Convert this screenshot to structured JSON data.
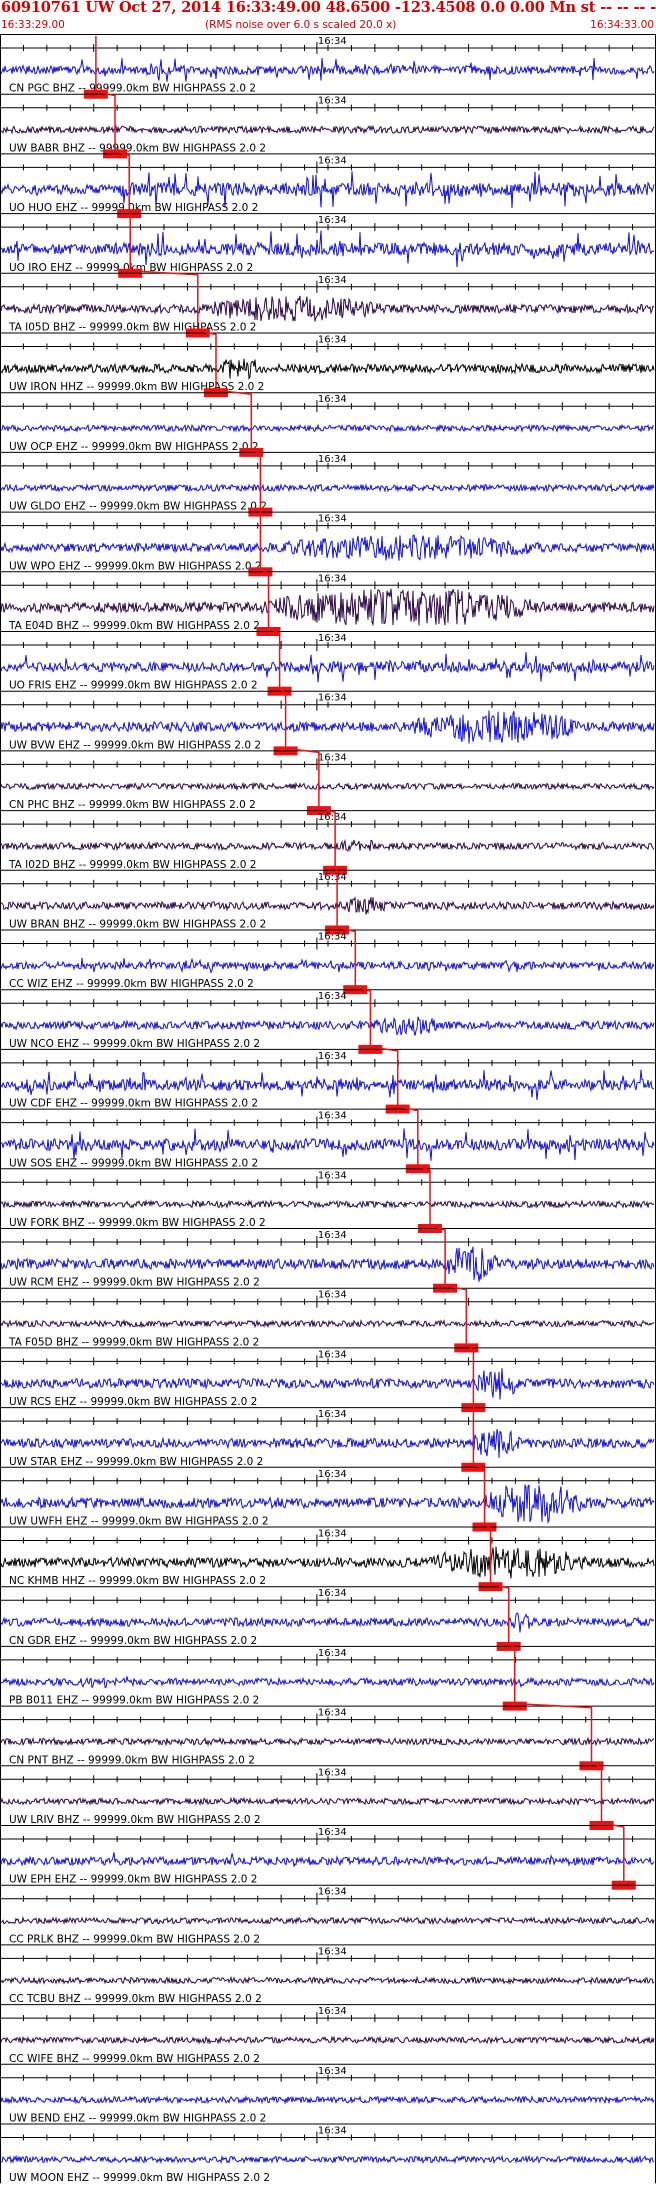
{
  "header": {
    "title": "60910761 UW Oct 27, 2014 16:33:49.00   48.6500 -123.4508  0.0 0.00 Mn st -- -- --  -1",
    "start_time": "16:33:29.00",
    "note": "(RMS noise over 6.0 s scaled 20.0 x)",
    "end_time": "16:34:33.00"
  },
  "colors": {
    "trace_blue": "#1010e0",
    "trace_dark": "#2c0848",
    "trace_black": "#000000",
    "pick": "#ee1111",
    "header_text": "#d00000",
    "rule": "#000000"
  },
  "chart_data": {
    "type": "line",
    "title": "60910761 UW Oct 27, 2014 16:33:49.00   48.6500 -123.4508  0.0 0.00 Mn st -- -- --  -1",
    "x_range": [
      "16:33:29.00",
      "16:34:33.00"
    ],
    "x_tick_label": "16:34",
    "x_tick_value": "16:34:00",
    "ticks_per_panel": 28,
    "series": [
      {
        "name": "CN PGC BHZ -- 99999.0km BW  HIGHPASS  2.0  2",
        "color": "#1010e0",
        "pick": "16:33:38.1",
        "amplitude": 0.55,
        "burst_start": "16:33:35",
        "burst_end": "16:34:33",
        "style": "spiky"
      },
      {
        "name": "UW BABR BHZ -- 99999.0km BW  HIGHPASS  2.0  2",
        "color": "#2c0848",
        "pick": "16:33:40.0",
        "amplitude": 0.28,
        "burst_start": "16:33:40",
        "burst_end": "16:34:10",
        "style": "noise"
      },
      {
        "name": "UO HUO EHZ -- 99999.0km BW  HIGHPASS  2.0  2",
        "color": "#1010e0",
        "pick": "16:33:41.4",
        "amplitude": 0.85,
        "burst_start": "16:33:40",
        "burst_end": "16:34:33",
        "style": "spiky"
      },
      {
        "name": "UO IRO EHZ -- 99999.0km BW  HIGHPASS  2.0  2",
        "color": "#1010e0",
        "pick": "16:33:41.5",
        "amplitude": 0.85,
        "burst_start": "16:33:40",
        "burst_end": "16:34:33",
        "style": "spiky"
      },
      {
        "name": "TA I05D BHZ -- 99999.0km BW  HIGHPASS  2.0  2",
        "color": "#2c0848",
        "pick": "16:33:48.2",
        "amplitude": 0.6,
        "burst_start": "16:33:47",
        "burst_end": "16:34:14",
        "style": "burst"
      },
      {
        "name": "UW IRON HHZ -- 99999.0km BW  HIGHPASS  2.0  2",
        "color": "#000000",
        "pick": "16:33:50.0",
        "amplitude": 0.65,
        "burst_start": "16:33:50",
        "burst_end": "16:33:56",
        "style": "burst"
      },
      {
        "name": "UW OCP EHZ -- 99999.0km BW  HIGHPASS  2.0  2",
        "color": "#1010e0",
        "pick": "16:33:53.5",
        "amplitude": 0.12,
        "burst_start": "16:33:53",
        "burst_end": "16:33:55",
        "style": "noise"
      },
      {
        "name": "UW GLDO EHZ -- 99999.0km BW  HIGHPASS  2.0  2",
        "color": "#1010e0",
        "pick": "16:33:54.4",
        "amplitude": 0.2,
        "burst_start": "16:33:33",
        "burst_end": "16:33:34",
        "style": "noise"
      },
      {
        "name": "UW WPO EHZ -- 99999.0km BW  HIGHPASS  2.0  2",
        "color": "#1010e0",
        "pick": "16:33:54.4",
        "amplitude": 0.6,
        "burst_start": "16:33:54",
        "burst_end": "16:34:33",
        "style": "burst"
      },
      {
        "name": "TA E04D BHZ -- 99999.0km BW  HIGHPASS  2.0  2",
        "color": "#2c0848",
        "pick": "16:33:55.2",
        "amplitude": 0.9,
        "burst_start": "16:33:53",
        "burst_end": "16:34:33",
        "style": "burst"
      },
      {
        "name": "UO FRIS EHZ -- 99999.0km BW  HIGHPASS  2.0  2",
        "color": "#1010e0",
        "pick": "16:33:56.3",
        "amplitude": 0.7,
        "burst_start": "16:33:55",
        "burst_end": "16:34:33",
        "style": "spiky"
      },
      {
        "name": "UW BVW EHZ -- 99999.0km BW  HIGHPASS  2.0  2",
        "color": "#1010e0",
        "pick": "16:33:56.9",
        "amplitude": 0.8,
        "burst_start": "16:34:08",
        "burst_end": "16:34:33",
        "style": "burst"
      },
      {
        "name": "CN PHC BHZ -- 99999.0km BW  HIGHPASS  2.0  2",
        "color": "#2c0848",
        "pick": "16:34:00.2",
        "amplitude": 0.12,
        "burst_start": "16:34:00",
        "burst_end": "16:34:05",
        "style": "noise"
      },
      {
        "name": "TA I02D BHZ -- 99999.0km BW  HIGHPASS  2.0  2",
        "color": "#2c0848",
        "pick": "16:34:01.8",
        "amplitude": 0.3,
        "burst_start": "16:34:01",
        "burst_end": "16:34:10",
        "style": "burst"
      },
      {
        "name": "UW BRAN BHZ -- 99999.0km BW  HIGHPASS  2.0  2",
        "color": "#2c0848",
        "pick": "16:34:02.0",
        "amplitude": 0.45,
        "burst_start": "16:34:02",
        "burst_end": "16:34:09",
        "style": "burst"
      },
      {
        "name": "CC WIZ EHZ -- 99999.0km BW  HIGHPASS  2.0  2",
        "color": "#1010e0",
        "pick": "16:34:03.8",
        "amplitude": 0.35,
        "burst_start": "16:33:34",
        "burst_end": "16:34:20",
        "style": "spiky"
      },
      {
        "name": "UW NCO EHZ -- 99999.0km BW  HIGHPASS  2.0  2",
        "color": "#1010e0",
        "pick": "16:34:05.3",
        "amplitude": 0.5,
        "burst_start": "16:34:05",
        "burst_end": "16:34:15",
        "style": "burst"
      },
      {
        "name": "UW CDF EHZ -- 99999.0km BW  HIGHPASS  2.0  2",
        "color": "#1010e0",
        "pick": "16:34:08.0",
        "amplitude": 0.7,
        "burst_start": "16:33:30",
        "burst_end": "16:34:33",
        "style": "spiky"
      },
      {
        "name": "UW SOS EHZ -- 99999.0km BW  HIGHPASS  2.0  2",
        "color": "#1010e0",
        "pick": "16:34:10.0",
        "amplitude": 0.75,
        "burst_start": "16:33:30",
        "burst_end": "16:34:33",
        "style": "spiky"
      },
      {
        "name": "UW FORK BHZ -- 99999.0km BW  HIGHPASS  2.0  2",
        "color": "#2c0848",
        "pick": "16:34:11.2",
        "amplitude": 0.22,
        "burst_start": "16:34:11",
        "burst_end": "16:34:20",
        "style": "noise"
      },
      {
        "name": "UW RCM EHZ -- 99999.0km BW  HIGHPASS  2.0  2",
        "color": "#1010e0",
        "pick": "16:34:12.7",
        "amplitude": 0.9,
        "burst_start": "16:34:12",
        "burst_end": "16:34:20",
        "style": "burst"
      },
      {
        "name": "TA F05D BHZ -- 99999.0km BW  HIGHPASS  2.0  2",
        "color": "#2c0848",
        "pick": "16:34:14.8",
        "amplitude": 0.12,
        "burst_start": "16:34:14",
        "burst_end": "16:34:18",
        "style": "noise"
      },
      {
        "name": "UW RCS EHZ -- 99999.0km BW  HIGHPASS  2.0  2",
        "color": "#1010e0",
        "pick": "16:34:15.5",
        "amplitude": 0.75,
        "burst_start": "16:34:15",
        "burst_end": "16:34:22",
        "style": "burst"
      },
      {
        "name": "UW STAR EHZ -- 99999.0km BW  HIGHPASS  2.0  2",
        "color": "#1010e0",
        "pick": "16:34:15.5",
        "amplitude": 0.7,
        "burst_start": "16:34:15",
        "burst_end": "16:34:22",
        "style": "burst"
      },
      {
        "name": "UW UWFH EHZ -- 99999.0km BW  HIGHPASS  2.0  2",
        "color": "#1010e0",
        "pick": "16:34:16.6",
        "amplitude": 0.95,
        "burst_start": "16:34:16",
        "burst_end": "16:34:30",
        "style": "burst"
      },
      {
        "name": "NC KHMB HHZ -- 99999.0km BW  HIGHPASS  2.0  2",
        "color": "#000000",
        "pick": "16:34:17.2",
        "amplitude": 0.75,
        "burst_start": "16:34:10",
        "burst_end": "16:34:33",
        "style": "burst"
      },
      {
        "name": "CN GDR EHZ -- 99999.0km BW  HIGHPASS  2.0  2",
        "color": "#1010e0",
        "pick": "16:34:19.0",
        "amplitude": 0.55,
        "burst_start": "16:34:19",
        "burst_end": "16:34:22",
        "style": "burst"
      },
      {
        "name": "PB B011 EHZ -- 99999.0km BW  HIGHPASS  2.0  2",
        "color": "#1010e0",
        "pick": "16:34:19.6",
        "amplitude": 0.35,
        "burst_start": "16:34:20",
        "burst_end": "16:34:21",
        "style": "spiky"
      },
      {
        "name": "CN PNT BHZ -- 99999.0km BW  HIGHPASS  2.0  2",
        "color": "#2c0848",
        "pick": "16:34:27.2",
        "amplitude": 0.2,
        "burst_start": "16:34:28",
        "burst_end": "16:34:29",
        "style": "noise"
      },
      {
        "name": "UW LRIV BHZ -- 99999.0km BW  HIGHPASS  2.0  2",
        "color": "#2c0848",
        "pick": "16:34:28.2",
        "amplitude": 0.12,
        "burst_start": "16:34:28",
        "burst_end": "16:34:30",
        "style": "noise"
      },
      {
        "name": "UW EPH EHZ -- 99999.0km BW  HIGHPASS  2.0  2",
        "color": "#1010e0",
        "pick": "16:34:30.4",
        "amplitude": 0.5,
        "burst_start": "16:33:53",
        "burst_end": "16:33:54",
        "style": "spiky"
      },
      {
        "name": "CC PRLK BHZ -- 99999.0km BW  HIGHPASS  2.0  2",
        "color": "#2c0848",
        "pick": null,
        "amplitude": 0.1,
        "burst_start": "16:33:29",
        "burst_end": "16:33:30",
        "style": "noise"
      },
      {
        "name": "CC TCBU BHZ -- 99999.0km BW  HIGHPASS  2.0  2",
        "color": "#2c0848",
        "pick": null,
        "amplitude": 0.1,
        "burst_start": "16:33:29",
        "burst_end": "16:33:30",
        "style": "noise"
      },
      {
        "name": "CC WIFE BHZ -- 99999.0km BW  HIGHPASS  2.0  2",
        "color": "#2c0848",
        "pick": null,
        "amplitude": 0.1,
        "burst_start": "16:33:29",
        "burst_end": "16:33:30",
        "style": "noise"
      },
      {
        "name": "UW BEND EHZ -- 99999.0km BW  HIGHPASS  2.0  2",
        "color": "#1010e0",
        "pick": null,
        "amplitude": 0.15,
        "burst_start": "16:33:29",
        "burst_end": "16:33:30",
        "style": "noise"
      },
      {
        "name": "UW MOON EHZ -- 99999.0km BW  HIGHPASS  2.0  2",
        "color": "#1010e0",
        "pick": null,
        "amplitude": 0.15,
        "burst_start": "16:33:29",
        "burst_end": "16:33:30",
        "style": "noise"
      }
    ]
  }
}
